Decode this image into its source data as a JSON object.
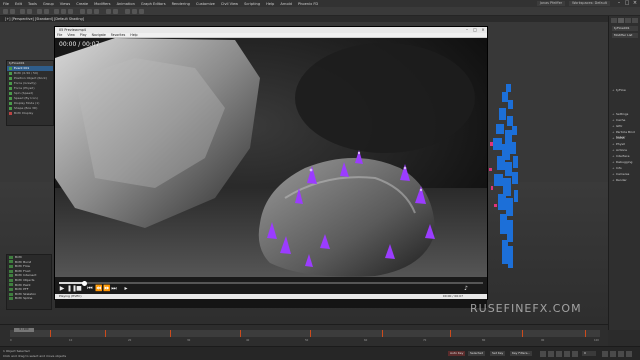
{
  "menubar": {
    "items": [
      "File",
      "Edit",
      "Tools",
      "Group",
      "Views",
      "Create",
      "Modifiers",
      "Animation",
      "Graph Editors",
      "Rendering",
      "Customize",
      "Civil View",
      "Scripting",
      "Help",
      "Arnold",
      "Phoenix FD"
    ],
    "workspace_user": "Jonas Pfeiffer",
    "workspace_label": "Workspaces: Default"
  },
  "viewport": {
    "label": "[+] [Perspective] [Standard] [Default Shading]"
  },
  "left_panel": {
    "header": "tyFlow001",
    "rows": [
      "Event 001",
      "Birth (0-50 / 50)",
      "Position Object (Rock)",
      "Force (Gravity)",
      "Force (PhysX)",
      "Spin (Speed)",
      "Speed (By Icon)",
      "Display Mode (1)",
      "Shape (Box 3D)",
      "Birth Display"
    ]
  },
  "operators": {
    "items": [
      "Birth",
      "Birth Burst",
      "Birth Flow",
      "Birth Fluid",
      "Birth Intersect",
      "Birth Objects",
      "Birth Paint",
      "Birth PFF",
      "Birth Skeleton",
      "Birth Spline"
    ]
  },
  "player": {
    "title": "05 Preview.mp4",
    "menu": [
      "File",
      "View",
      "Play",
      "Navigate",
      "Favorites",
      "Help"
    ],
    "time": "00:00 / 00:07",
    "progress": 0.06,
    "status": "Playing (HVEC)",
    "status_right": "00:00 / 00:07"
  },
  "command_panel": {
    "object_name": "tyFlow001",
    "modifier_list": "Modifier List",
    "rollouts": [
      "tyFlow",
      "Settings",
      "Cache",
      "GPU",
      "Particle Bind Solver",
      "CUDA",
      "PhysX",
      "Actions",
      "Interface",
      "Debugging",
      "Info",
      "Cameras",
      "Render"
    ]
  },
  "timeline": {
    "slider_label": "0 / 100",
    "ticks": [
      "0",
      "10",
      "20",
      "30",
      "40",
      "50",
      "60",
      "70",
      "80",
      "90",
      "100"
    ]
  },
  "statusbar": {
    "line1": "1 Object Selected",
    "line2": "Click and drag to select and move objects",
    "auto_key": "Auto Key",
    "selected": "Selected",
    "set_key": "Set Key",
    "key_filters": "Key Filters...",
    "frame": "0"
  },
  "watermark": "RUSEFINEFX.COM",
  "colors": {
    "accent_selected": "#2f5d8a",
    "timeline_key": "#cc4b1c",
    "particle_purple": "#9b3cff"
  }
}
